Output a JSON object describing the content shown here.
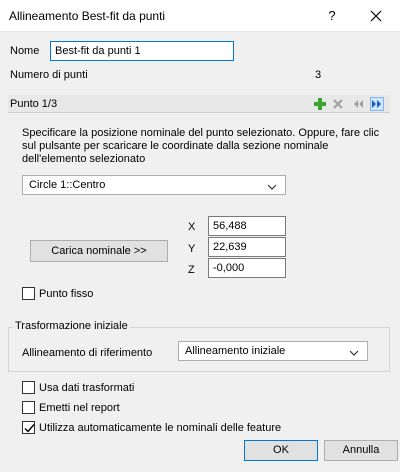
{
  "window": {
    "title": "Allineamento Best-fit da punti",
    "help_label": "?",
    "close_icon": "close-icon"
  },
  "name": {
    "label": "Nome",
    "value": "Best-fit da punti 1"
  },
  "point_count": {
    "label": "Numero di punti",
    "value": "3"
  },
  "point_section": {
    "title": "Punto 1/3",
    "toolbar": {
      "add_icon": "plus-icon",
      "delete_icon": "delete-x-icon",
      "prev_icon": "previous-icon",
      "next_icon": "next-icon",
      "add_color": "#3aa52f"
    },
    "instructions": "Specificare la posizione nominale del punto selezionato. Oppure, fare clic sul pulsante per scaricare le coordinate dalla sezione nominale dell'elemento selezionato",
    "feature_select": {
      "value": "Circle 1::Centro"
    },
    "load_button": "Carica nominale >>",
    "coords": {
      "x_label": "X",
      "x_value": "56,488",
      "y_label": "Y",
      "y_value": "22,639",
      "z_label": "Z",
      "z_value": "-0,000"
    },
    "fixed_point": {
      "label": "Punto fisso",
      "checked": false
    }
  },
  "initial_transform": {
    "title": "Trasformazione iniziale",
    "ref_label": "Allineamento di riferimento",
    "ref_value": "Allineamento iniziale"
  },
  "options": {
    "use_transformed": {
      "label": "Usa dati trasformati",
      "checked": false
    },
    "report": {
      "label": "Emetti nel report",
      "checked": false
    },
    "auto_nominals": {
      "label": "Utilizza automaticamente le nominali delle feature",
      "checked": true
    }
  },
  "footer": {
    "ok": "OK",
    "cancel": "Annulla"
  },
  "colors": {
    "accent": "#0078d7"
  }
}
